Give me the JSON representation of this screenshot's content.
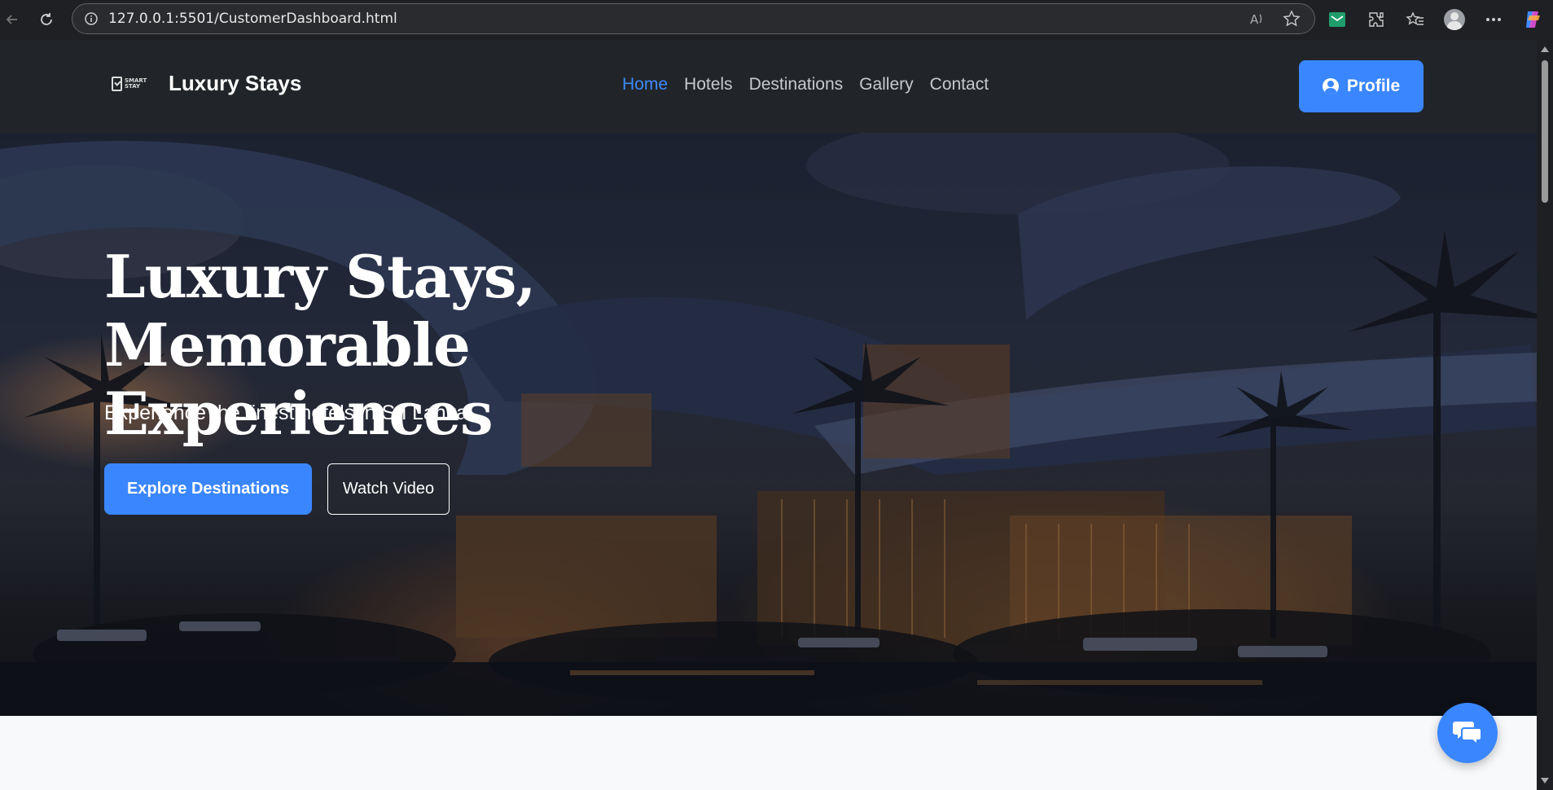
{
  "browser": {
    "url": "127.0.0.1:5501/CustomerDashboard.html",
    "icons": [
      "back-arrow-icon",
      "reload-icon",
      "site-info-icon",
      "read-aloud-icon",
      "favorite-star-icon",
      "mail-extension-icon",
      "extensions-icon",
      "favorites-icon",
      "profile-avatar-icon",
      "more-options-icon",
      "copilot-icon"
    ]
  },
  "navbar": {
    "logo_lines": [
      "SMART",
      "STAY"
    ],
    "brand": "Luxury Stays",
    "links": [
      {
        "label": "Home",
        "active": true
      },
      {
        "label": "Hotels"
      },
      {
        "label": "Destinations"
      },
      {
        "label": "Gallery"
      },
      {
        "label": "Contact"
      }
    ],
    "profile_label": "Profile"
  },
  "hero": {
    "title_line1": "Luxury Stays,",
    "title_line2": "Memorable Experiences",
    "subtitle": "Experience the finest hotels in Sri Lanka...",
    "primary_cta": "Explore Destinations",
    "secondary_cta": "Watch Video"
  },
  "colors": {
    "accent": "#3a86ff",
    "nav_bg": "#212529",
    "active_link": "#3d8bfd"
  }
}
